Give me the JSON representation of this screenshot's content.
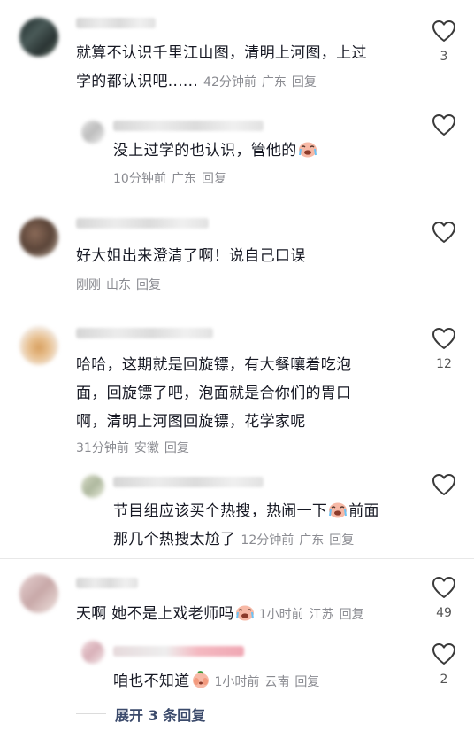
{
  "comments": [
    {
      "text_lines": [
        "就算不认识千里江山图，清明上河图，上过",
        "学的都认识吧......"
      ],
      "time": "42分钟前",
      "location": "广东",
      "reply_label": "回复",
      "likes": "3"
    },
    {
      "text_lines": [
        "没上过学的也认识，管他的"
      ],
      "time": "10分钟前",
      "location": "广东",
      "reply_label": "回复",
      "likes": ""
    },
    {
      "text_lines": [
        "好大姐出来澄清了啊！说自己口误"
      ],
      "time": "刚刚",
      "location": "山东",
      "reply_label": "回复",
      "likes": ""
    },
    {
      "text_lines": [
        "哈哈，这期就是回旋镖，有大餐嚷着吃泡",
        "面，回旋镖了吧，泡面就是合你们的胃口",
        "啊，清明上河图回旋镖，花学家呢"
      ],
      "time": "31分钟前",
      "location": "安徽",
      "reply_label": "回复",
      "likes": "12"
    },
    {
      "text_lines": [
        "节目组应该买个热搜，热闹一下",
        "前面",
        "那几个热搜太尬了"
      ],
      "time": "12分钟前",
      "location": "广东",
      "reply_label": "回复",
      "likes": ""
    },
    {
      "text_lines": [
        "天啊 她不是上戏老师吗"
      ],
      "time": "1小时前",
      "location": "江苏",
      "reply_label": "回复",
      "likes": "49"
    },
    {
      "text_lines": [
        "咱也不知道"
      ],
      "time": "1小时前",
      "location": "云南",
      "reply_label": "回复",
      "likes": "2"
    }
  ],
  "expand_replies": "展开 3 条回复",
  "colors": {
    "text": "#161823",
    "meta": "#8a8b91",
    "expand": "#3b4a6b"
  },
  "icons": {
    "like": "heart-outline-icon",
    "emoji_cry": "crying-face-emoji",
    "emoji_blush": "blushing-cover-face-emoji"
  }
}
